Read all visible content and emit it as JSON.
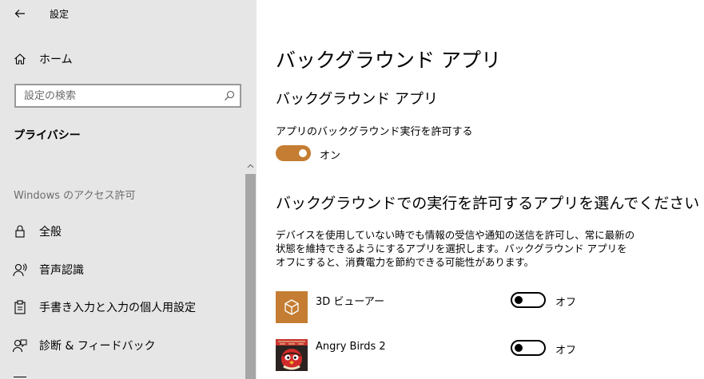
{
  "window": {
    "title": "設定"
  },
  "sidebar": {
    "home_label": "ホーム",
    "search_placeholder": "設定の検索",
    "section_title": "プライバシー",
    "group_label": "Windows のアクセス許可",
    "items": [
      {
        "label": "全般",
        "icon": "lock-icon"
      },
      {
        "label": "音声認識",
        "icon": "speech-icon"
      },
      {
        "label": "手書き入力と入力の個人用設定",
        "icon": "clipboard-icon"
      },
      {
        "label": "診断 & フィードバック",
        "icon": "feedback-icon"
      }
    ]
  },
  "main": {
    "page_title": "バックグラウンド アプリ",
    "section1_title": "バックグラウンド アプリ",
    "allow_label": "アプリのバックグラウンド実行を許可する",
    "allow_state": "オン",
    "section2_title": "バックグラウンドでの実行を許可するアプリを選んでください",
    "description": "デバイスを使用していない時でも情報の受信や通知の送信を許可し、常に最新の状態を維持できるようにするアプリを選択します。バックグラウンド アプリをオフにすると、消費電力を節約できる可能性があります。",
    "apps": [
      {
        "name": "3D ビューアー",
        "state": "オフ",
        "tile_color": "#c47d32",
        "icon": "cube-icon"
      },
      {
        "name": "Angry Birds 2",
        "state": "オフ",
        "icon": "angry-birds-icon"
      }
    ]
  },
  "colors": {
    "accent": "#c47d32",
    "sidebar_bg": "#e6e6e6",
    "scroll_thumb": "#a6a6a6"
  }
}
